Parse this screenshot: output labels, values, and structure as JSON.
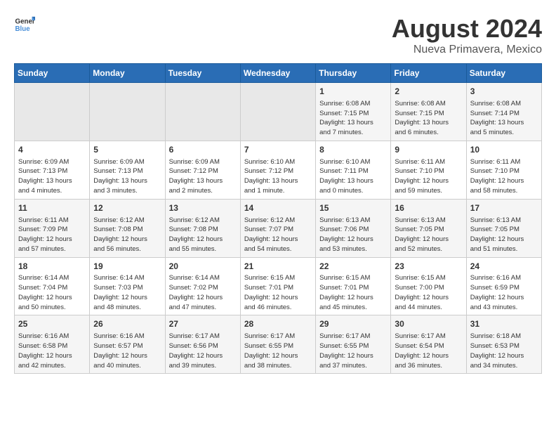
{
  "header": {
    "logo_line1": "General",
    "logo_line2": "Blue",
    "title": "August 2024",
    "subtitle": "Nueva Primavera, Mexico"
  },
  "weekdays": [
    "Sunday",
    "Monday",
    "Tuesday",
    "Wednesday",
    "Thursday",
    "Friday",
    "Saturday"
  ],
  "weeks": [
    [
      {
        "day": "",
        "info": ""
      },
      {
        "day": "",
        "info": ""
      },
      {
        "day": "",
        "info": ""
      },
      {
        "day": "",
        "info": ""
      },
      {
        "day": "1",
        "info": "Sunrise: 6:08 AM\nSunset: 7:15 PM\nDaylight: 13 hours\nand 7 minutes."
      },
      {
        "day": "2",
        "info": "Sunrise: 6:08 AM\nSunset: 7:15 PM\nDaylight: 13 hours\nand 6 minutes."
      },
      {
        "day": "3",
        "info": "Sunrise: 6:08 AM\nSunset: 7:14 PM\nDaylight: 13 hours\nand 5 minutes."
      }
    ],
    [
      {
        "day": "4",
        "info": "Sunrise: 6:09 AM\nSunset: 7:13 PM\nDaylight: 13 hours\nand 4 minutes."
      },
      {
        "day": "5",
        "info": "Sunrise: 6:09 AM\nSunset: 7:13 PM\nDaylight: 13 hours\nand 3 minutes."
      },
      {
        "day": "6",
        "info": "Sunrise: 6:09 AM\nSunset: 7:12 PM\nDaylight: 13 hours\nand 2 minutes."
      },
      {
        "day": "7",
        "info": "Sunrise: 6:10 AM\nSunset: 7:12 PM\nDaylight: 13 hours\nand 1 minute."
      },
      {
        "day": "8",
        "info": "Sunrise: 6:10 AM\nSunset: 7:11 PM\nDaylight: 13 hours\nand 0 minutes."
      },
      {
        "day": "9",
        "info": "Sunrise: 6:11 AM\nSunset: 7:10 PM\nDaylight: 12 hours\nand 59 minutes."
      },
      {
        "day": "10",
        "info": "Sunrise: 6:11 AM\nSunset: 7:10 PM\nDaylight: 12 hours\nand 58 minutes."
      }
    ],
    [
      {
        "day": "11",
        "info": "Sunrise: 6:11 AM\nSunset: 7:09 PM\nDaylight: 12 hours\nand 57 minutes."
      },
      {
        "day": "12",
        "info": "Sunrise: 6:12 AM\nSunset: 7:08 PM\nDaylight: 12 hours\nand 56 minutes."
      },
      {
        "day": "13",
        "info": "Sunrise: 6:12 AM\nSunset: 7:08 PM\nDaylight: 12 hours\nand 55 minutes."
      },
      {
        "day": "14",
        "info": "Sunrise: 6:12 AM\nSunset: 7:07 PM\nDaylight: 12 hours\nand 54 minutes."
      },
      {
        "day": "15",
        "info": "Sunrise: 6:13 AM\nSunset: 7:06 PM\nDaylight: 12 hours\nand 53 minutes."
      },
      {
        "day": "16",
        "info": "Sunrise: 6:13 AM\nSunset: 7:05 PM\nDaylight: 12 hours\nand 52 minutes."
      },
      {
        "day": "17",
        "info": "Sunrise: 6:13 AM\nSunset: 7:05 PM\nDaylight: 12 hours\nand 51 minutes."
      }
    ],
    [
      {
        "day": "18",
        "info": "Sunrise: 6:14 AM\nSunset: 7:04 PM\nDaylight: 12 hours\nand 50 minutes."
      },
      {
        "day": "19",
        "info": "Sunrise: 6:14 AM\nSunset: 7:03 PM\nDaylight: 12 hours\nand 48 minutes."
      },
      {
        "day": "20",
        "info": "Sunrise: 6:14 AM\nSunset: 7:02 PM\nDaylight: 12 hours\nand 47 minutes."
      },
      {
        "day": "21",
        "info": "Sunrise: 6:15 AM\nSunset: 7:01 PM\nDaylight: 12 hours\nand 46 minutes."
      },
      {
        "day": "22",
        "info": "Sunrise: 6:15 AM\nSunset: 7:01 PM\nDaylight: 12 hours\nand 45 minutes."
      },
      {
        "day": "23",
        "info": "Sunrise: 6:15 AM\nSunset: 7:00 PM\nDaylight: 12 hours\nand 44 minutes."
      },
      {
        "day": "24",
        "info": "Sunrise: 6:16 AM\nSunset: 6:59 PM\nDaylight: 12 hours\nand 43 minutes."
      }
    ],
    [
      {
        "day": "25",
        "info": "Sunrise: 6:16 AM\nSunset: 6:58 PM\nDaylight: 12 hours\nand 42 minutes."
      },
      {
        "day": "26",
        "info": "Sunrise: 6:16 AM\nSunset: 6:57 PM\nDaylight: 12 hours\nand 40 minutes."
      },
      {
        "day": "27",
        "info": "Sunrise: 6:17 AM\nSunset: 6:56 PM\nDaylight: 12 hours\nand 39 minutes."
      },
      {
        "day": "28",
        "info": "Sunrise: 6:17 AM\nSunset: 6:55 PM\nDaylight: 12 hours\nand 38 minutes."
      },
      {
        "day": "29",
        "info": "Sunrise: 6:17 AM\nSunset: 6:55 PM\nDaylight: 12 hours\nand 37 minutes."
      },
      {
        "day": "30",
        "info": "Sunrise: 6:17 AM\nSunset: 6:54 PM\nDaylight: 12 hours\nand 36 minutes."
      },
      {
        "day": "31",
        "info": "Sunrise: 6:18 AM\nSunset: 6:53 PM\nDaylight: 12 hours\nand 34 minutes."
      }
    ]
  ]
}
